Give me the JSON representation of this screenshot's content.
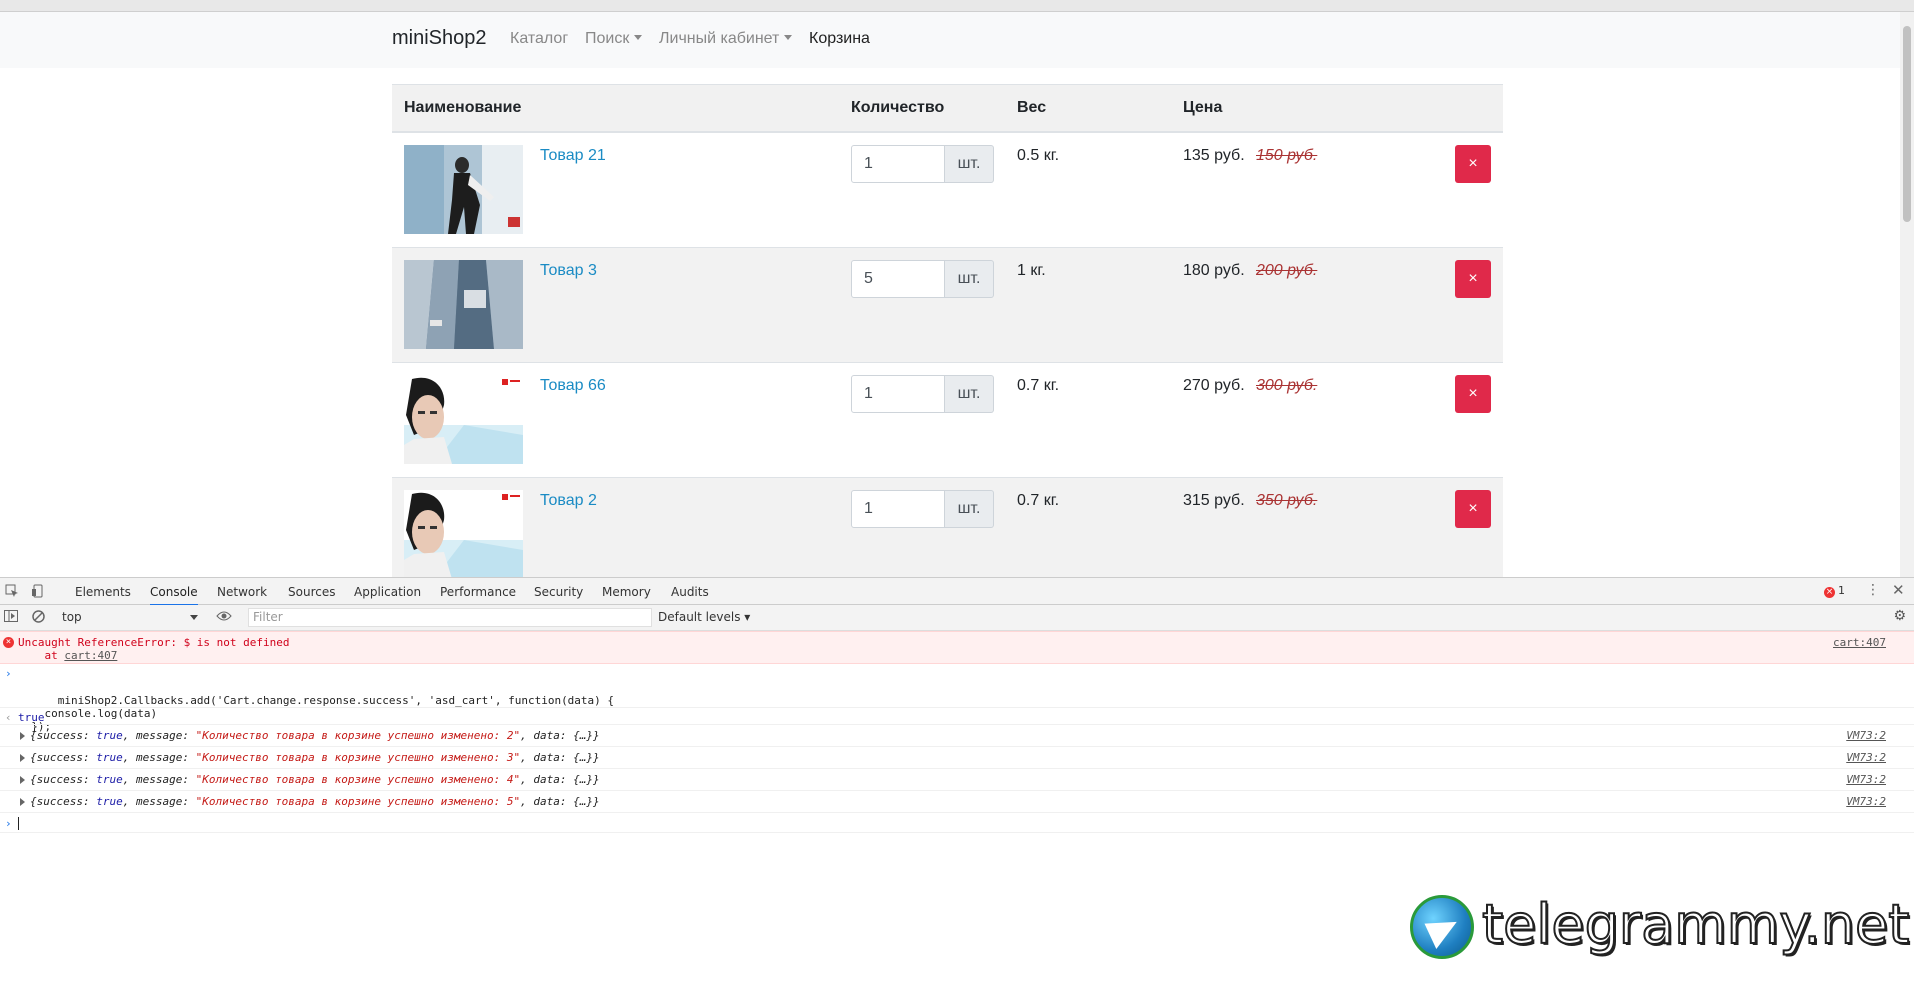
{
  "navbar": {
    "brand": "miniShop2",
    "links": [
      {
        "label": "Каталог"
      },
      {
        "label": "Поиск"
      },
      {
        "label": "Личный кабинет"
      },
      {
        "label": "Корзина"
      }
    ]
  },
  "table": {
    "headers": [
      "Наименование",
      "Количество",
      "Вес",
      "Цена"
    ],
    "rows": [
      {
        "name": "Товар 21",
        "qty": "1",
        "unit": "шт.",
        "weight": "0.5 кг.",
        "price": "135 руб.",
        "old_price": "150 руб.",
        "delete": "×"
      },
      {
        "name": "Товар 3",
        "qty": "5",
        "unit": "шт.",
        "weight": "1 кг.",
        "price": "180 руб.",
        "old_price": "200 руб.",
        "delete": "×"
      },
      {
        "name": "Товар 66",
        "qty": "1",
        "unit": "шт.",
        "weight": "0.7 кг.",
        "price": "270 руб.",
        "old_price": "300 руб.",
        "delete": "×"
      },
      {
        "name": "Товар 2",
        "qty": "1",
        "unit": "шт.",
        "weight": "0.7 кг.",
        "price": "315 руб.",
        "old_price": "350 руб.",
        "delete": "×"
      }
    ]
  },
  "devtools": {
    "tabs": [
      "Elements",
      "Console",
      "Network",
      "Sources",
      "Application",
      "Performance",
      "Security",
      "Memory",
      "Audits"
    ],
    "active_tab": "Console",
    "error_count": "1",
    "context": "top",
    "filter_placeholder": "Filter",
    "levels": "Default levels",
    "error": {
      "message": "Uncaught ReferenceError: $ is not defined",
      "at_prefix": "    at ",
      "at_link": "cart:407",
      "source": "cart:407"
    },
    "input": "miniShop2.Callbacks.add('Cart.change.response.success', 'asd_cart', function(data) {\n    console.log(data)\n  });",
    "result": "true",
    "logs": [
      {
        "prefix": "{success: ",
        "kw": "true",
        "mid": ", message: ",
        "msg": "\"Количество товара в корзине успешно изменено: 2\"",
        "suffix": ", data: {…}}",
        "source": "VM73:2"
      },
      {
        "prefix": "{success: ",
        "kw": "true",
        "mid": ", message: ",
        "msg": "\"Количество товара в корзине успешно изменено: 3\"",
        "suffix": ", data: {…}}",
        "source": "VM73:2"
      },
      {
        "prefix": "{success: ",
        "kw": "true",
        "mid": ", message: ",
        "msg": "\"Количество товара в корзине успешно изменено: 4\"",
        "suffix": ", data: {…}}",
        "source": "VM73:2"
      },
      {
        "prefix": "{success: ",
        "kw": "true",
        "mid": ", message: ",
        "msg": "\"Количество товара в корзине успешно изменено: 5\"",
        "suffix": ", data: {…}}",
        "source": "VM73:2"
      }
    ]
  },
  "watermark": {
    "text": "telegrammy.net"
  },
  "colors": {
    "delete_button": "#e0294a",
    "link": "#1a8bc4",
    "old_price": "#a33"
  }
}
